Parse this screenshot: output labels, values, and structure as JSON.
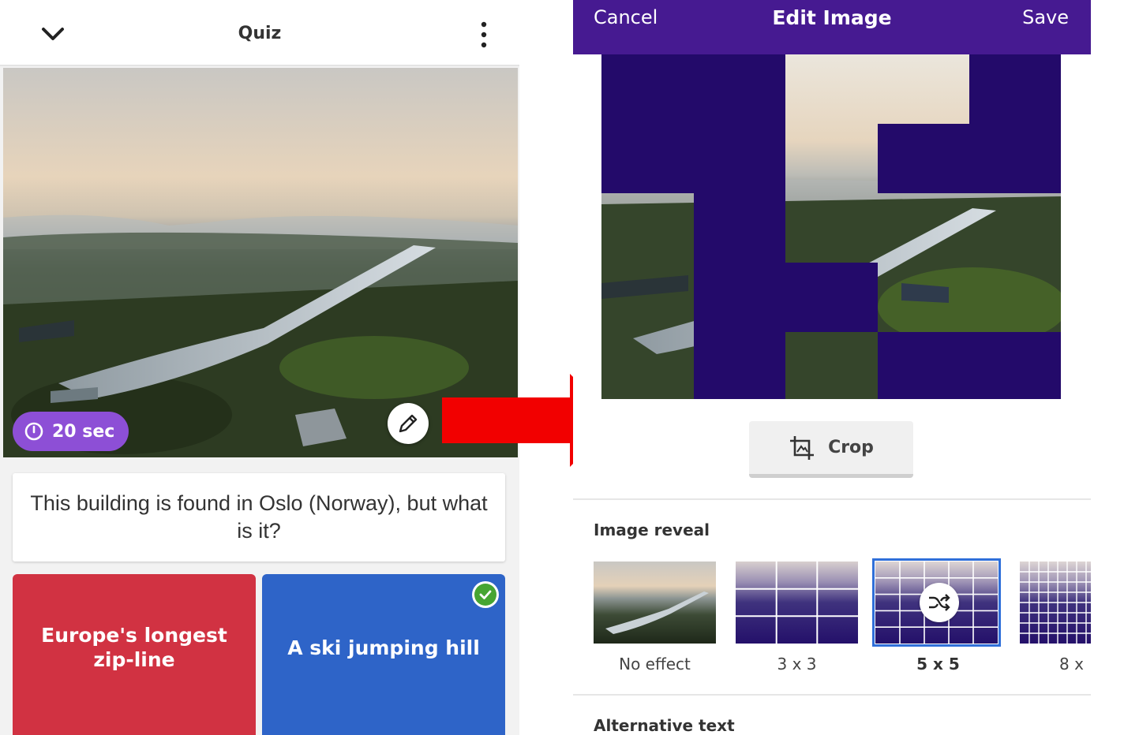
{
  "quiz_screen": {
    "title": "Quiz",
    "timer_label": "20 sec",
    "question": "This building is found in Oslo (Norway), but what is it?",
    "answers": [
      {
        "text": "Europe's longest zip-line",
        "color": "#d13242",
        "correct": false
      },
      {
        "text": "A ski jumping hill",
        "color": "#2e64c8",
        "correct": true
      }
    ],
    "icons": [
      "chevron-down-icon",
      "more-vert-icon",
      "clock-icon",
      "pencil-icon",
      "check-icon"
    ]
  },
  "edit_screen": {
    "cancel_label": "Cancel",
    "title": "Edit Image",
    "save_label": "Save",
    "crop_label": "Crop",
    "image_reveal_label": "Image reveal",
    "reveal_options": [
      {
        "label": "No effect",
        "selected": false
      },
      {
        "label": "3 x 3",
        "selected": false
      },
      {
        "label": "5 x 5",
        "selected": true
      },
      {
        "label": "8 x",
        "selected": false
      }
    ],
    "alt_text_label": "Alternative text",
    "accent_color": "#461a91",
    "selection_color": "#2f6fd9"
  },
  "arrow_color": "#f20000"
}
